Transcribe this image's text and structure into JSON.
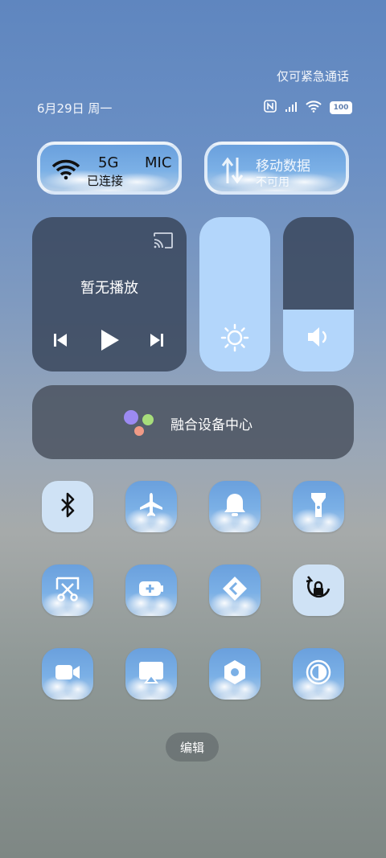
{
  "status": {
    "emergency_text": "仅可紧急通话",
    "date_text": "6月29日 周一",
    "battery": "100",
    "icons": [
      "nfc-icon",
      "signal-icon",
      "wifi-icon",
      "battery-icon"
    ]
  },
  "wifi_toggle": {
    "title": "5G",
    "subtitle": "已连接",
    "network_name_partial": "MIC",
    "state": "on"
  },
  "mobile_data_toggle": {
    "title": "移动数据",
    "subtitle": "不可用",
    "state": "unavailable"
  },
  "media": {
    "status_text": "暂无播放",
    "cast_icon": "cast-icon"
  },
  "sliders": {
    "brightness_level": 1.0,
    "volume_level": 0.4
  },
  "device_center": {
    "label": "融合设备中心"
  },
  "tiles": [
    {
      "name": "bluetooth",
      "icon": "bluetooth-icon",
      "active": true
    },
    {
      "name": "airplane-mode",
      "icon": "airplane-icon",
      "active": false
    },
    {
      "name": "sound",
      "icon": "bell-icon",
      "active": false
    },
    {
      "name": "flashlight",
      "icon": "flashlight-icon",
      "active": false
    },
    {
      "name": "screenshot",
      "icon": "scissors-icon",
      "active": false
    },
    {
      "name": "battery-saver",
      "icon": "battery-plus-icon",
      "active": false
    },
    {
      "name": "nearby-share",
      "icon": "share-diamond-icon",
      "active": false
    },
    {
      "name": "rotation-lock",
      "icon": "rotation-lock-icon",
      "active": true
    },
    {
      "name": "screen-record",
      "icon": "video-camera-icon",
      "active": false
    },
    {
      "name": "screen-cast",
      "icon": "cast-screen-icon",
      "active": false
    },
    {
      "name": "settings",
      "icon": "hex-gear-icon",
      "active": false
    },
    {
      "name": "dark-mode",
      "icon": "dark-mode-icon",
      "active": false
    }
  ],
  "edit": {
    "label": "编辑"
  },
  "colors": {
    "accent_light_blue": "#b3d6fb",
    "panel_dark": "#3a465c"
  }
}
